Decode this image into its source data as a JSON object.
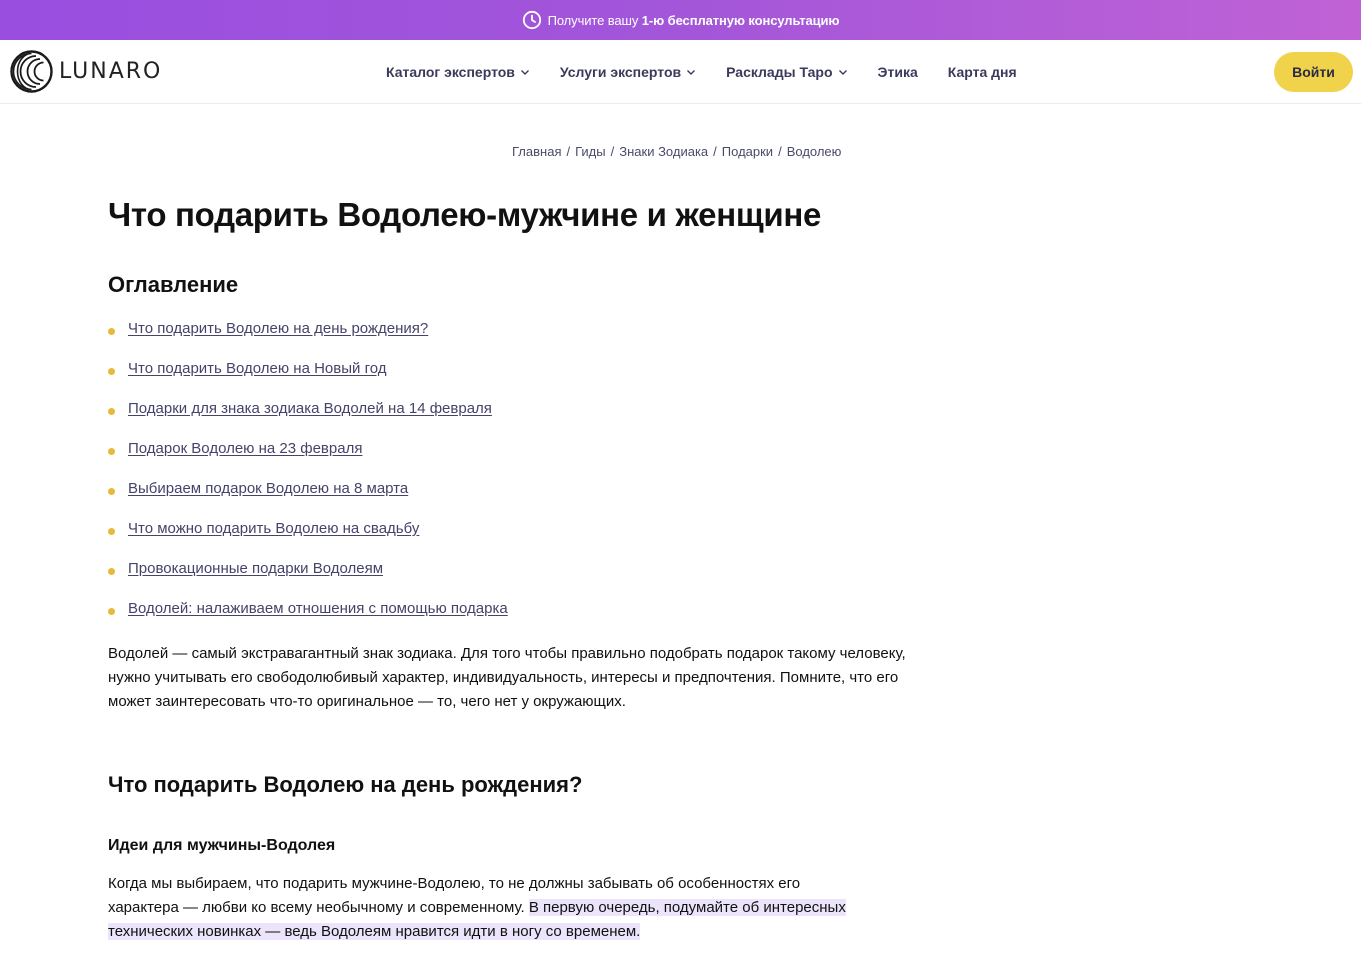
{
  "promo": {
    "text_before": "Получите вашу ",
    "text_strong": "1-ю бесплатную консультацию",
    "icon": "clock-icon"
  },
  "header": {
    "logo_text": "LUNARO",
    "nav": [
      {
        "label": "Каталог экспертов",
        "dropdown": true
      },
      {
        "label": "Услуги экспертов",
        "dropdown": true
      },
      {
        "label": "Расклады Таро",
        "dropdown": true
      },
      {
        "label": "Этика",
        "dropdown": false
      },
      {
        "label": "Карта дня",
        "dropdown": false
      }
    ],
    "login_label": "Войти"
  },
  "breadcrumb": [
    "Главная",
    "Гиды",
    "Знаки Зодиака",
    "Подарки",
    "Водолею"
  ],
  "page_title": "Что подарить Водолею-мужчине и женщине",
  "toc": {
    "title": "Оглавление",
    "items": [
      "Что подарить Водолею на день рождения?",
      "Что подарить Водолею на Новый год",
      "Подарки для знака зодиака Водолей на 14 февраля",
      "Подарок Водолею на 23 февраля",
      "Выбираем подарок Водолею на 8 марта",
      "Что можно подарить Водолею на свадьбу",
      "Провокационные подарки Водолеям",
      "Водолей: налаживаем отношения с помощью подарка"
    ]
  },
  "intro": "Водолей — самый экстравагантный знак зодиака. Для того чтобы правильно подобрать подарок такому человеку, нужно учитывать его свободолюбивый характер, индивидуальность, интересы и предпочтения. Помните, что его может заинтересовать что-то оригинальное — то, чего нет у окружающих.",
  "section": {
    "title": "Что подарить Водолею на день рождения?",
    "subtitle": "Идеи для мужчины-Водолея",
    "para_plain": "Когда мы выбираем, что подарить мужчине-Водолею, то не должны забывать об особенностях его характера — любви ко всему необычному и современному. ",
    "para_highlight": "В первую очередь, подумайте об интересных технических новинках — ведь Водолеям нравится идти в ногу со временем."
  },
  "colors": {
    "accent_yellow": "#f0d34a",
    "promo_purple": "#a356d9",
    "link": "#45436a",
    "highlight": "#ece4fb"
  }
}
